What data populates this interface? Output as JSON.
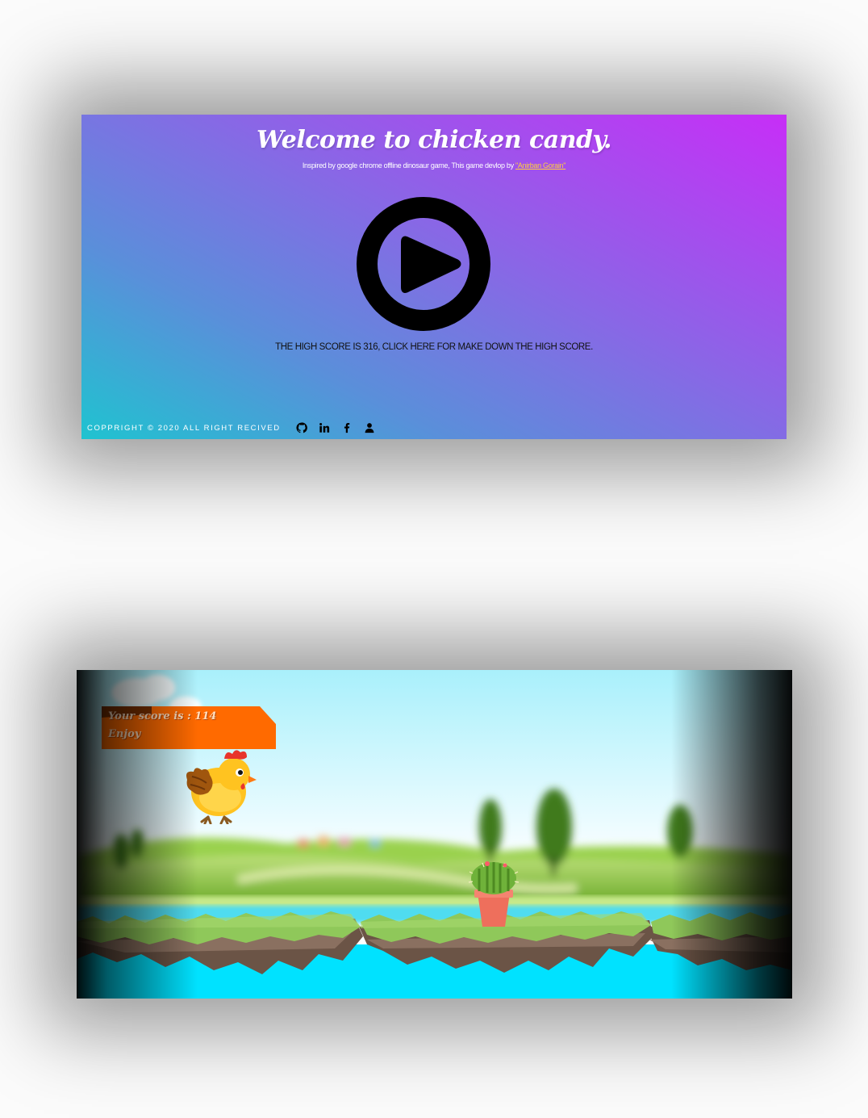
{
  "welcome": {
    "title": "Welcome to chicken candy.",
    "subtitle_prefix": "Inspired by google chrome offline dinosaur game, This game devlop by ",
    "author_link": "\"Anirban Gorain\"",
    "high_score_text": "THE HIGH SCORE IS 316, CLICK HERE FOR MAKE DOWN THE HIGH SCORE.",
    "play_icon": "play-circle-icon",
    "gradient_colors": [
      "#1fc3d0",
      "#8a66e6",
      "#c72ef7"
    ]
  },
  "footer": {
    "copyright": "COPPRIGHT © 2020 ALL RIGHT RECIVED",
    "social_icons": [
      "github-icon",
      "linkedin-icon",
      "facebook-icon",
      "user-icon"
    ]
  },
  "game": {
    "score_line": "Your score is : 114",
    "message": "Enjoy",
    "banner_color": "#ff6a00",
    "player": "chicken",
    "obstacle": "potted-cactus",
    "water_color": "#00e2ff",
    "grass_color": "#8fc85a"
  }
}
